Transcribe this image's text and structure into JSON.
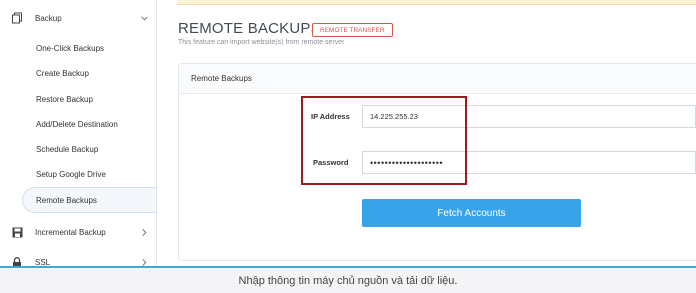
{
  "sidebar": {
    "backup_section": {
      "label": "Backup",
      "icon": "backup-icon"
    },
    "items": [
      {
        "label": "One-Click Backups"
      },
      {
        "label": "Create Backup"
      },
      {
        "label": "Restore Backup"
      },
      {
        "label": "Add/Delete Destination"
      },
      {
        "label": "Schedule Backup"
      },
      {
        "label": "Setup Google Drive"
      },
      {
        "label": "Remote Backups",
        "active": true
      }
    ],
    "incremental_section": {
      "label": "Incremental Backup",
      "icon": "save-icon"
    },
    "ssl_section": {
      "label": "SSL",
      "icon": "lock-icon"
    }
  },
  "main": {
    "title": "REMOTE BACKUPS -",
    "badge": "REMOTE TRANSFER",
    "subtitle": "This feature can import website(s) from remote server",
    "card": {
      "title": "Remote Backups",
      "ip_label": "IP Address",
      "ip_value": "14.225.255.23",
      "password_label": "Password",
      "password_value": "••••••••••••••••••••",
      "fetch_button": "Fetch Accounts"
    }
  },
  "caption": "Nhập thông tin máy chủ nguồn và tải dữ liệu.",
  "colors": {
    "accent": "#38a3e9",
    "badge": "#e0534d",
    "highlight": "#9b1c1c",
    "caption_border": "#3fa9d6"
  }
}
